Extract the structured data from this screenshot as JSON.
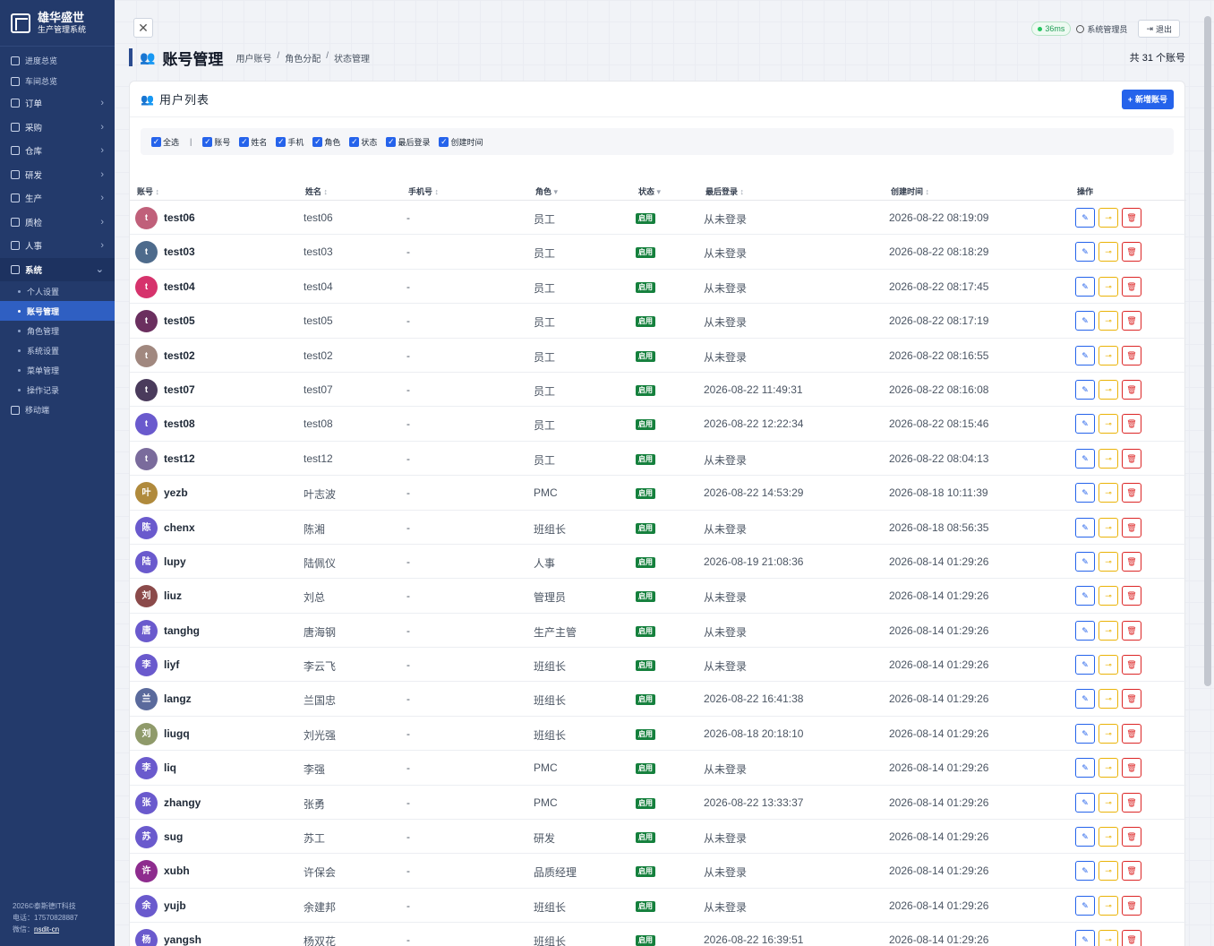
{
  "brand": {
    "title": "雄华盛世",
    "subtitle": "生产管理系统"
  },
  "sidebar": {
    "top_items": [
      {
        "label": "进度总览",
        "icon": "dashboard-icon"
      },
      {
        "label": "车间总览",
        "icon": "monitor-icon"
      }
    ],
    "groups": [
      {
        "label": "订单",
        "icon": "order-icon"
      },
      {
        "label": "采购",
        "icon": "cart-icon"
      },
      {
        "label": "仓库",
        "icon": "warehouse-icon"
      },
      {
        "label": "研发",
        "icon": "bulb-icon"
      },
      {
        "label": "生产",
        "icon": "gear-icon"
      },
      {
        "label": "质检",
        "icon": "shield-check-icon"
      },
      {
        "label": "人事",
        "icon": "people-icon"
      }
    ],
    "open_group": {
      "label": "系统",
      "icon": "shield-icon"
    },
    "sub_items": [
      "个人设置",
      "账号管理",
      "角色管理",
      "系统设置",
      "菜单管理",
      "操作记录"
    ],
    "active_sub": "账号管理",
    "bottom_item": {
      "label": "移动端",
      "icon": "mobile-icon"
    },
    "footer": {
      "copyright": "2026©泰斯德IT科技",
      "phone": "电话：17570828887",
      "wechat_label": "微信：",
      "wechat": "nsdit-cn"
    }
  },
  "topbar": {
    "close": "✕",
    "ping": "36ms",
    "user": "系统管理员",
    "logout": "退出"
  },
  "header": {
    "title": "账号管理",
    "breadcrumbs": [
      "用户账号",
      "角色分配",
      "状态管理"
    ],
    "total": "共 31 个账号"
  },
  "card": {
    "title": "用户列表",
    "add_button": "新增账号"
  },
  "filters": {
    "select_all": "全选",
    "columns": [
      "账号",
      "姓名",
      "手机",
      "角色",
      "状态",
      "最后登录",
      "创建时间"
    ]
  },
  "table": {
    "columns": [
      {
        "label": "账号",
        "sort": "↕"
      },
      {
        "label": "姓名",
        "sort": "↕"
      },
      {
        "label": "手机号",
        "sort": "↕"
      },
      {
        "label": "角色",
        "sort": "▾"
      },
      {
        "label": "状态",
        "sort": "▾"
      },
      {
        "label": "最后登录",
        "sort": "↕"
      },
      {
        "label": "创建时间",
        "sort": "↕"
      },
      {
        "label": "操作",
        "sort": ""
      }
    ],
    "rows": [
      {
        "initial": "t",
        "color": "#c0607a",
        "account": "test06",
        "name": "test06",
        "phone": "-",
        "role": "员工",
        "status": "启用",
        "last_login": "从未登录",
        "created": "2026-08-22 08:19:09"
      },
      {
        "initial": "t",
        "color": "#4e6b8c",
        "account": "test03",
        "name": "test03",
        "phone": "-",
        "role": "员工",
        "status": "启用",
        "last_login": "从未登录",
        "created": "2026-08-22 08:18:29"
      },
      {
        "initial": "t",
        "color": "#d6336c",
        "account": "test04",
        "name": "test04",
        "phone": "-",
        "role": "员工",
        "status": "启用",
        "last_login": "从未登录",
        "created": "2026-08-22 08:17:45"
      },
      {
        "initial": "t",
        "color": "#6b2f5f",
        "account": "test05",
        "name": "test05",
        "phone": "-",
        "role": "员工",
        "status": "启用",
        "last_login": "从未登录",
        "created": "2026-08-22 08:17:19"
      },
      {
        "initial": "t",
        "color": "#a1887f",
        "account": "test02",
        "name": "test02",
        "phone": "-",
        "role": "员工",
        "status": "启用",
        "last_login": "从未登录",
        "created": "2026-08-22 08:16:55"
      },
      {
        "initial": "t",
        "color": "#4a3b5c",
        "account": "test07",
        "name": "test07",
        "phone": "-",
        "role": "员工",
        "status": "启用",
        "last_login": "2026-08-22 11:49:31",
        "created": "2026-08-22 08:16:08"
      },
      {
        "initial": "t",
        "color": "#6a5acd",
        "account": "test08",
        "name": "test08",
        "phone": "-",
        "role": "员工",
        "status": "启用",
        "last_login": "2026-08-22 12:22:34",
        "created": "2026-08-22 08:15:46"
      },
      {
        "initial": "t",
        "color": "#7a6b9c",
        "account": "test12",
        "name": "test12",
        "phone": "-",
        "role": "员工",
        "status": "启用",
        "last_login": "从未登录",
        "created": "2026-08-22 08:04:13"
      },
      {
        "initial": "叶",
        "color": "#b08a3c",
        "account": "yezb",
        "name": "叶志波",
        "phone": "-",
        "role": "PMC",
        "status": "启用",
        "last_login": "2026-08-22 14:53:29",
        "created": "2026-08-18 10:11:39"
      },
      {
        "initial": "陈",
        "color": "#6a5acd",
        "account": "chenx",
        "name": "陈湘",
        "phone": "-",
        "role": "班组长",
        "status": "启用",
        "last_login": "从未登录",
        "created": "2026-08-18 08:56:35"
      },
      {
        "initial": "陆",
        "color": "#6a5acd",
        "account": "lupy",
        "name": "陆佩仪",
        "phone": "-",
        "role": "人事",
        "status": "启用",
        "last_login": "2026-08-19 21:08:36",
        "created": "2026-08-14 01:29:26"
      },
      {
        "initial": "刘",
        "color": "#8b4a4a",
        "account": "liuz",
        "name": "刘总",
        "phone": "-",
        "role": "管理员",
        "status": "启用",
        "last_login": "从未登录",
        "created": "2026-08-14 01:29:26"
      },
      {
        "initial": "唐",
        "color": "#6a5acd",
        "account": "tanghg",
        "name": "唐海钢",
        "phone": "-",
        "role": "生产主管",
        "status": "启用",
        "last_login": "从未登录",
        "created": "2026-08-14 01:29:26"
      },
      {
        "initial": "李",
        "color": "#6a5acd",
        "account": "liyf",
        "name": "李云飞",
        "phone": "-",
        "role": "班组长",
        "status": "启用",
        "last_login": "从未登录",
        "created": "2026-08-14 01:29:26"
      },
      {
        "initial": "兰",
        "color": "#5a6a9c",
        "account": "langz",
        "name": "兰国忠",
        "phone": "-",
        "role": "班组长",
        "status": "启用",
        "last_login": "2026-08-22 16:41:38",
        "created": "2026-08-14 01:29:26"
      },
      {
        "initial": "刘",
        "color": "#8f9a6a",
        "account": "liugq",
        "name": "刘光强",
        "phone": "-",
        "role": "班组长",
        "status": "启用",
        "last_login": "2026-08-18 20:18:10",
        "created": "2026-08-14 01:29:26"
      },
      {
        "initial": "李",
        "color": "#6a5acd",
        "account": "liq",
        "name": "李强",
        "phone": "-",
        "role": "PMC",
        "status": "启用",
        "last_login": "从未登录",
        "created": "2026-08-14 01:29:26"
      },
      {
        "initial": "张",
        "color": "#6a5acd",
        "account": "zhangy",
        "name": "张勇",
        "phone": "-",
        "role": "PMC",
        "status": "启用",
        "last_login": "2026-08-22 13:33:37",
        "created": "2026-08-14 01:29:26"
      },
      {
        "initial": "苏",
        "color": "#6a5acd",
        "account": "sug",
        "name": "苏工",
        "phone": "-",
        "role": "研发",
        "status": "启用",
        "last_login": "从未登录",
        "created": "2026-08-14 01:29:26"
      },
      {
        "initial": "许",
        "color": "#8e2c8e",
        "account": "xubh",
        "name": "许保会",
        "phone": "-",
        "role": "品质经理",
        "status": "启用",
        "last_login": "从未登录",
        "created": "2026-08-14 01:29:26"
      },
      {
        "initial": "余",
        "color": "#6a5acd",
        "account": "yujb",
        "name": "余建邦",
        "phone": "-",
        "role": "班组长",
        "status": "启用",
        "last_login": "从未登录",
        "created": "2026-08-14 01:29:26"
      },
      {
        "initial": "杨",
        "color": "#6a5acd",
        "account": "yangsh",
        "name": "杨双花",
        "phone": "-",
        "role": "班组长",
        "status": "启用",
        "last_login": "2026-08-22 16:39:51",
        "created": "2026-08-14 01:29:26"
      }
    ],
    "actions": {
      "edit": "✎",
      "key": "⊸",
      "delete": "🗑"
    }
  }
}
